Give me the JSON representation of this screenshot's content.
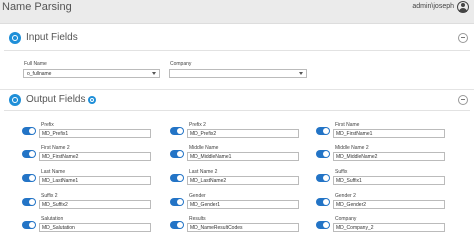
{
  "header": {
    "title": "Name Parsing",
    "user": "admin\\joseph"
  },
  "input_fields": {
    "title": "Input Fields",
    "full_name": {
      "label": "Full Name",
      "value": "o_fullname"
    },
    "company": {
      "label": "Company",
      "value": ""
    }
  },
  "output_fields": {
    "title": "Output Fields",
    "rows": [
      [
        {
          "label": "Prefix",
          "value": "MD_Prefix1"
        },
        {
          "label": "Prefix 2",
          "value": "MD_Prefix2"
        },
        {
          "label": "First Name",
          "value": "MD_FirstName1"
        }
      ],
      [
        {
          "label": "First Name 2",
          "value": "MD_FirstName2"
        },
        {
          "label": "Middle Name",
          "value": "MD_MiddleName1"
        },
        {
          "label": "Middle Name 2",
          "value": "MD_MiddleName2"
        }
      ],
      [
        {
          "label": "Last Name",
          "value": "MD_LastName1"
        },
        {
          "label": "Last Name 2",
          "value": "MD_LastName2"
        },
        {
          "label": "Suffix",
          "value": "MD_Suffix1"
        }
      ],
      [
        {
          "label": "Suffix 2",
          "value": "MD_Suffix2"
        },
        {
          "label": "Gender",
          "value": "MD_Gender1"
        },
        {
          "label": "Gender 2",
          "value": "MD_Gender2"
        }
      ],
      [
        {
          "label": "Salutation",
          "value": "MD_Salutation"
        },
        {
          "label": "Results",
          "value": "MD_NameResultCodes"
        },
        {
          "label": "Company",
          "value": "MD_Company_2"
        }
      ]
    ]
  }
}
